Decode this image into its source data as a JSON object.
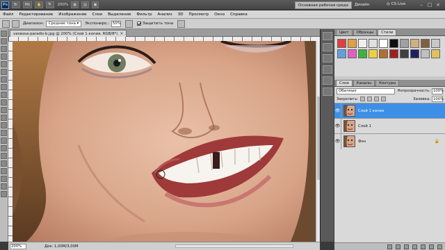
{
  "app": {
    "logo": "Ps",
    "zoom": "200%",
    "workspace_button": "Основная рабочая среда",
    "workspace_design": "Дизайн",
    "cs_live": "CS Live"
  },
  "menu": [
    "Файл",
    "Редактирование",
    "Изображение",
    "Слои",
    "Выделение",
    "Фильтр",
    "Анализ",
    "3D",
    "Просмотр",
    "Окно",
    "Справка"
  ],
  "options": {
    "range_label": "Диапазон:",
    "range_value": "Средние тона",
    "exposure_label": "Экспониро.:",
    "exposure_value": "50%",
    "protect_label": "Защитить тона",
    "protect_checked": true
  },
  "document": {
    "tab_title": "vanessa-paradis-b.jpg @ 200% (Слой 1 копия, RGB/8*)",
    "close": "×"
  },
  "status": {
    "zoom": "200%",
    "doc_info": "Док: 1,00M/3,00M"
  },
  "panels": {
    "top_tabs": [
      "Цвет",
      "Образцы",
      "Стили"
    ],
    "active_top_tab": "Стили",
    "style_swatches": [
      "#e04040",
      "#e0a040",
      "#f0f0f0",
      "#e0e0e0",
      "#ffffff",
      "#101010",
      "#a0a0a0",
      "#d0b080",
      "#806040",
      "#c8c8c8",
      "#60a0e0",
      "#e060c0",
      "#40b040",
      "#f0d040",
      "#b07030",
      "#a02020",
      "#404040",
      "#202060",
      "#c0c0c0",
      "#e0c060"
    ],
    "layer_tabs": [
      "Слои",
      "Каналы",
      "Контуры"
    ],
    "active_layer_tab": "Слои",
    "blend_mode": "Обычные",
    "opacity_label": "Непрозрачность:",
    "opacity_value": "100%",
    "lock_label": "Закрепить:",
    "fill_label": "Заливка:",
    "fill_value": "100%",
    "layers": [
      {
        "name": "Слой 1 копия",
        "selected": true,
        "locked": false
      },
      {
        "name": "Слой 1",
        "selected": false,
        "locked": false
      },
      {
        "name": "Фон",
        "selected": false,
        "locked": true
      }
    ]
  }
}
